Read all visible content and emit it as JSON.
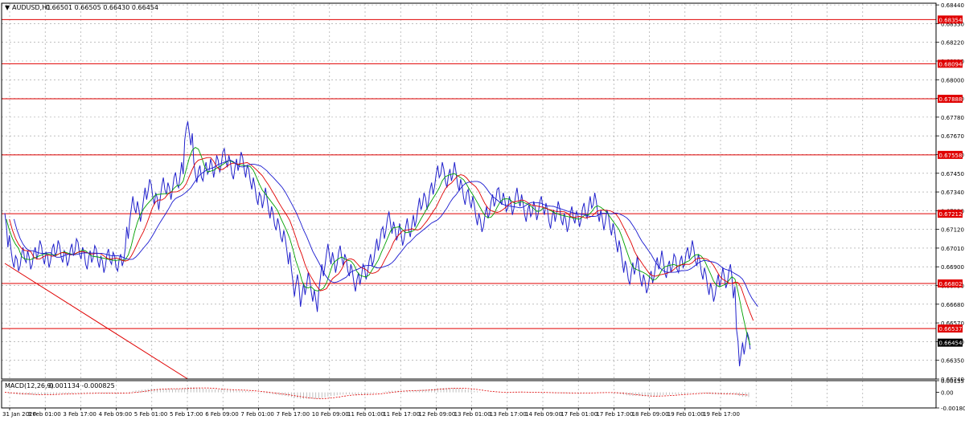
{
  "header": {
    "symbol_text": "AUDUSD,H1",
    "ohlc_text": "0.66501 0.66505 0.66430 0.66454"
  },
  "chart_data": {
    "type": "line",
    "symbol": "AUDUSD",
    "timeframe": "H1",
    "ohlc": {
      "open": 0.66501,
      "high": 0.66505,
      "low": 0.6643,
      "close": 0.66454
    },
    "y_axis": {
      "range": [
        0.6624,
        0.6845
      ],
      "ticks": [
        0.6624,
        0.6635,
        0.6646,
        0.6657,
        0.6668,
        0.6679,
        0.669,
        0.6701,
        0.6712,
        0.6723,
        0.6734,
        0.6745,
        0.6756,
        0.6767,
        0.6778,
        0.6789,
        0.68,
        0.6811,
        0.6822,
        0.6833,
        0.6844
      ],
      "tick_labels": [
        "0.66240",
        "0.66350",
        "0.66460",
        "0.66570",
        "0.66680",
        "0.66790",
        "0.66900",
        "0.67010",
        "0.67120",
        "0.67230",
        "0.67340",
        "0.67450",
        "0.67560",
        "0.67670",
        "0.67780",
        "0.67890",
        "0.68000",
        "0.68110",
        "0.68220",
        "0.68330",
        "0.68440"
      ]
    },
    "x_axis": {
      "tick_labels": [
        "31 Jan 2020",
        "3 Feb 01:00",
        "3 Feb 17:00",
        "4 Feb 09:00",
        "5 Feb 01:00",
        "5 Feb 17:00",
        "6 Feb 09:00",
        "7 Feb 01:00",
        "7 Feb 17:00",
        "10 Feb 09:00",
        "11 Feb 01:00",
        "11 Feb 17:00",
        "12 Feb 09:00",
        "13 Feb 01:00",
        "13 Feb 17:00",
        "14 Feb 09:00",
        "17 Feb 01:00",
        "17 Feb 17:00",
        "18 Feb 09:00",
        "19 Feb 01:00",
        "19 Feb 17:00"
      ]
    },
    "horizontal_levels": [
      {
        "value": 0.68354,
        "label": "0.68354"
      },
      {
        "value": 0.68094,
        "label": "0.68094"
      },
      {
        "value": 0.67888,
        "label": "0.67888"
      },
      {
        "value": 0.67558,
        "label": "0.67558"
      },
      {
        "value": 0.67212,
        "label": "0.67212"
      },
      {
        "value": 0.66802,
        "label": "0.66802"
      },
      {
        "value": 0.66537,
        "label": "0.66537"
      }
    ],
    "current_price": {
      "value": 0.66454,
      "label": "0.66454"
    },
    "trend_line": {
      "from": {
        "bar": 0,
        "price": 0.6692
      },
      "to": {
        "bar": 60,
        "price": 0.6624
      }
    },
    "price_series": [
      0.6718,
      0.6705,
      0.6697,
      0.6693,
      0.6691,
      0.6694,
      0.6698,
      0.6696,
      0.6692,
      0.6695,
      0.6698,
      0.6702,
      0.6699,
      0.6695,
      0.6693,
      0.6697,
      0.67,
      0.6702,
      0.6699,
      0.6696,
      0.6694,
      0.6697,
      0.67,
      0.6703,
      0.6701,
      0.6698,
      0.6695,
      0.6692,
      0.6696,
      0.6699,
      0.6697,
      0.6693,
      0.669,
      0.6694,
      0.6697,
      0.6695,
      0.6693,
      0.6691,
      0.6694,
      0.6697,
      0.671,
      0.6721,
      0.6728,
      0.6725,
      0.672,
      0.6726,
      0.6733,
      0.6738,
      0.6735,
      0.673,
      0.6727,
      0.6734,
      0.6739,
      0.6736,
      0.6733,
      0.6739,
      0.6742,
      0.674,
      0.6748,
      0.6768,
      0.6772,
      0.6765,
      0.6748,
      0.6743,
      0.6746,
      0.6744,
      0.6748,
      0.675,
      0.6746,
      0.6752,
      0.6749,
      0.6754,
      0.6756,
      0.6752,
      0.6748,
      0.6745,
      0.675,
      0.6754,
      0.6751,
      0.6746,
      0.6744,
      0.6739,
      0.6734,
      0.673,
      0.6728,
      0.6733,
      0.6727,
      0.6722,
      0.6718,
      0.6715,
      0.6711,
      0.6708,
      0.6703,
      0.6695,
      0.6685,
      0.6676,
      0.6682,
      0.667,
      0.6677,
      0.6683,
      0.6679,
      0.6673,
      0.6667,
      0.668,
      0.6688,
      0.6694,
      0.67,
      0.6695,
      0.669,
      0.6695,
      0.6699,
      0.6694,
      0.6691,
      0.6688,
      0.6684,
      0.6679,
      0.6683,
      0.6688,
      0.6686,
      0.669,
      0.6694,
      0.6697,
      0.6703,
      0.6708,
      0.671,
      0.6715,
      0.6719,
      0.6713,
      0.6709,
      0.6712,
      0.6706,
      0.671,
      0.6715,
      0.6711,
      0.6717,
      0.6721,
      0.6727,
      0.673,
      0.6727,
      0.6732,
      0.6736,
      0.6741,
      0.6746,
      0.6748,
      0.6744,
      0.674,
      0.6744,
      0.6748,
      0.6742,
      0.6738,
      0.6734,
      0.673,
      0.6732,
      0.6728,
      0.6723,
      0.6718,
      0.6714,
      0.6717,
      0.6722,
      0.6725,
      0.6729,
      0.6732,
      0.6733,
      0.673,
      0.6726,
      0.6728,
      0.6724,
      0.6728,
      0.6733,
      0.6729,
      0.6724,
      0.672,
      0.6723,
      0.6725,
      0.6721,
      0.6725,
      0.6728,
      0.6724,
      0.672,
      0.6716,
      0.672,
      0.6725,
      0.6721,
      0.6718,
      0.6714,
      0.6718,
      0.6722,
      0.6719,
      0.6717,
      0.6721,
      0.6724,
      0.6722,
      0.6728,
      0.673,
      0.6725,
      0.672,
      0.6715,
      0.672,
      0.6717,
      0.6712,
      0.6708,
      0.6702,
      0.6697,
      0.669,
      0.6686,
      0.6683,
      0.6689,
      0.6693,
      0.6686,
      0.6682,
      0.6678,
      0.6681,
      0.6684,
      0.6688,
      0.6692,
      0.6696,
      0.669,
      0.6687,
      0.669,
      0.6694,
      0.6692,
      0.669,
      0.6693,
      0.6695,
      0.6698,
      0.6702,
      0.6697,
      0.6694,
      0.669,
      0.6686,
      0.6682,
      0.6677,
      0.6673,
      0.6677,
      0.6682,
      0.6686,
      0.6681,
      0.6684,
      0.6688,
      0.6675,
      0.665,
      0.6635,
      0.6642,
      0.6648,
      0.6645
    ],
    "indicator": {
      "name": "MACD(12,26,9)",
      "values_text": "-0.001134 -0.000825",
      "y_ticks": [
        0.001357,
        0.0,
        -0.001807
      ],
      "y_tick_labels": [
        "0.001357",
        "0.00",
        "-0.001807"
      ]
    }
  },
  "colors": {
    "price": "#2222cc",
    "ma_fast": "#00a000",
    "ma_mid": "#e00000",
    "ma_slow": "#1a1ad0",
    "level": "#e00000",
    "level_label_bg": "#e00000",
    "current_label_bg": "#000000",
    "grid": "#9a9a9a",
    "macd_histogram": "#b0b0b0",
    "macd_signal": "#e00000"
  }
}
